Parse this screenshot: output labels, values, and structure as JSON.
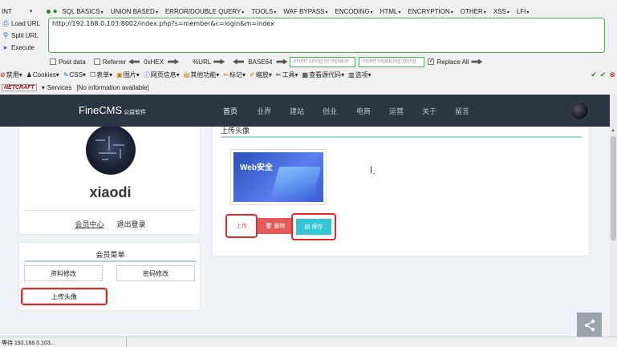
{
  "hackbar": {
    "select_value": "INT",
    "menu": [
      "SQL BASICS",
      "UNION BASED",
      "ERROR/DOUBLE QUERY",
      "TOOLS",
      "WAF BYPASS",
      "ENCODING",
      "HTML",
      "ENCRYPTION",
      "OTHER",
      "XSS",
      "LFI"
    ],
    "actions": {
      "load_url": "Load URL",
      "split_url": "Split URL",
      "execute": "Execute"
    },
    "url": "http://192.168.0.103:8002/index.php?s=member&c=login&m=index",
    "options": {
      "post_data": "Post data",
      "referrer": "Referrer",
      "hex": "0xHEX",
      "url": "%URL",
      "base64": "BASE64",
      "replace_placeholder": "Insert string to replace",
      "replacing_placeholder": "Insert replacing string",
      "replace_all": "Replace All"
    }
  },
  "toolbar2": {
    "items": [
      "禁用",
      "Cookies",
      "CSS",
      "表单",
      "图片",
      "网页信息",
      "其他功能",
      "标记",
      "缩放",
      "工具",
      "查看源代码",
      "选项"
    ]
  },
  "toolbar3": {
    "netcraft": "NETCRAFT",
    "services": "Services",
    "info": "[No information available]"
  },
  "site": {
    "logo": "FineCMS",
    "logo_sub": "公益软件",
    "nav": [
      "首页",
      "业界",
      "建站",
      "创业",
      "电商",
      "运营",
      "关于",
      "留言"
    ],
    "username": "xiaodi",
    "member_center": "会员中心",
    "logout": "退出登录",
    "member_menu_title": "会员菜单",
    "edit_profile": "资料修改",
    "change_password": "密码修改",
    "upload_avatar": "上传头像",
    "section_title": "上传头像",
    "image_caption": "Web安全",
    "upload_btn": "上传",
    "delete_btn": "删除",
    "save_btn": "保存",
    "colors": {
      "nav_bg": "#2b3643",
      "danger": "#e35b5b",
      "info": "#36c6d3",
      "highlight": "#e02a2a"
    }
  },
  "status_bar": {
    "text": "等待 192.168.0.103..."
  }
}
